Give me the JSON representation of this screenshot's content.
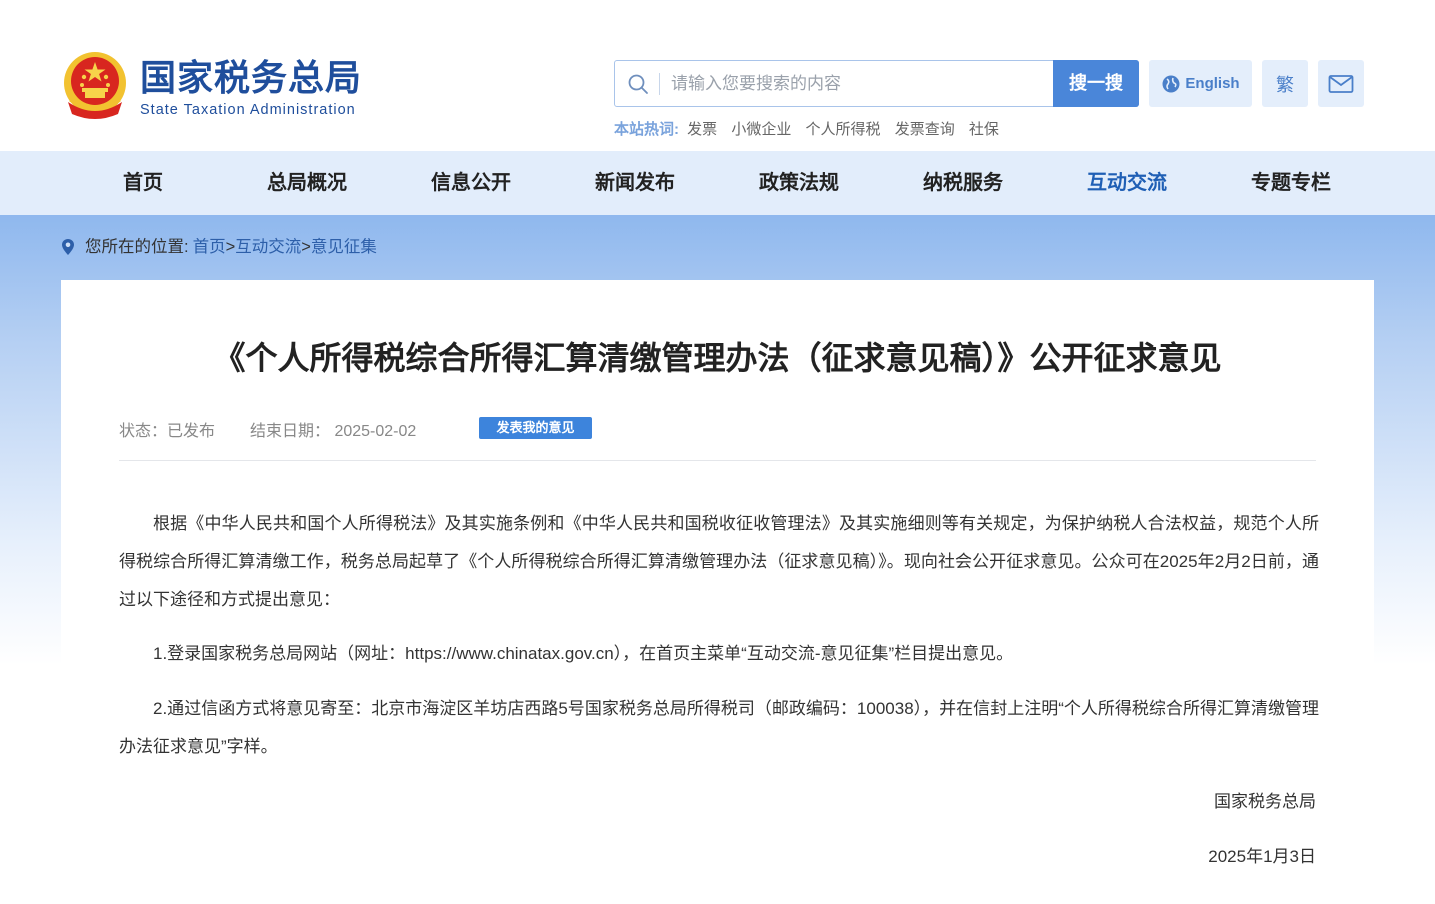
{
  "header": {
    "title_cn": "国家税务总局",
    "title_en": "State Taxation Administration",
    "search": {
      "placeholder": "请输入您要搜索的内容",
      "button_label": "搜一搜"
    },
    "english_label": "English",
    "traditional_label": "繁",
    "hot": {
      "label": "本站热词:",
      "items": [
        "发票",
        "小微企业",
        "个人所得税",
        "发票查询",
        "社保"
      ]
    }
  },
  "nav": {
    "items": [
      "首页",
      "总局概况",
      "信息公开",
      "新闻发布",
      "政策法规",
      "纳税服务",
      "互动交流",
      "专题专栏"
    ],
    "active": "互动交流"
  },
  "breadcrumb": {
    "label": "您所在的位置:",
    "items": [
      "首页",
      "互动交流",
      "意见征集"
    ],
    "separator": ">"
  },
  "article": {
    "title": "《个人所得税综合所得汇算清缴管理办法（征求意见稿）》公开征求意见",
    "status": "状态：已发布",
    "end_date": "结束日期：  2025-02-02",
    "opinion_button": "发表我的意见",
    "paragraphs": [
      "根据《中华人民共和国个人所得税法》及其实施条例和《中华人民共和国税收征收管理法》及其实施细则等有关规定，为保护纳税人合法权益，规范个人所得税综合所得汇算清缴工作，税务总局起草了《个人所得税综合所得汇算清缴管理办法（征求意见稿）》。现向社会公开征求意见。公众可在2025年2月2日前，通过以下途径和方式提出意见：",
      "1.登录国家税务总局网站（网址：https://www.chinatax.gov.cn），在首页主菜单“互动交流-意见征集”栏目提出意见。",
      "2.通过信函方式将意见寄至：北京市海淀区羊坊店西路5号国家税务总局所得税司（邮政编码：100038），并在信封上注明“个人所得税综合所得汇算清缴管理办法征求意见”字样。"
    ],
    "signature": "国家税务总局",
    "date": "2025年1月3日"
  },
  "colors": {
    "brand_blue": "#1f4e9c",
    "nav_bg": "#e2edfb",
    "button_blue": "#4a86d9",
    "active_nav": "#1f5fb5"
  },
  "icons": [
    "national-emblem-logo",
    "search-icon",
    "globe-icon",
    "mail-icon",
    "location-pin-icon"
  ]
}
